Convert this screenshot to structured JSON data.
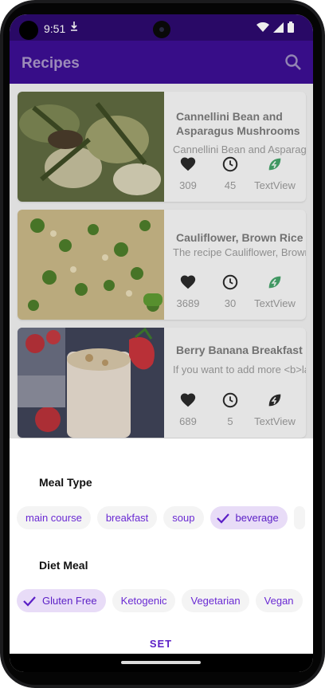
{
  "status_bar": {
    "time": "9:51"
  },
  "app_bar": {
    "title": "Recipes",
    "search_icon": "search-icon"
  },
  "recipes": [
    {
      "title": "Cannellini Bean and Asparagus Mushrooms",
      "description": "Cannellini Bean and Asparagus Mushrooms",
      "likes": "309",
      "minutes": "45",
      "vegan_label": "TextView",
      "vegan": true
    },
    {
      "title": "Cauliflower, Brown Rice, and Vegetable Fried Rice",
      "description": "The recipe Cauliflower, Brown Rice, and Vegetable Fried Rice",
      "likes": "3689",
      "minutes": "30",
      "vegan_label": "TextView",
      "vegan": true
    },
    {
      "title": "Berry Banana Breakfast Smoothie",
      "description": "If you want to add more <b>lacto ovo vegetarian</b>",
      "likes": "689",
      "minutes": "5",
      "vegan_label": "TextView",
      "vegan": false
    }
  ],
  "filter_sheet": {
    "meal_type": {
      "title": "Meal Type",
      "chips": [
        {
          "label": "main course",
          "selected": false
        },
        {
          "label": "breakfast",
          "selected": false
        },
        {
          "label": "soup",
          "selected": false
        },
        {
          "label": "beverage",
          "selected": true
        }
      ]
    },
    "diet": {
      "title": "Diet Meal",
      "chips": [
        {
          "label": "Gluten Free",
          "selected": true
        },
        {
          "label": "Ketogenic",
          "selected": false
        },
        {
          "label": "Vegetarian",
          "selected": false
        },
        {
          "label": "Vegan",
          "selected": false
        }
      ]
    },
    "set_label": "SET"
  },
  "colors": {
    "status_bar": "#2d0a6e",
    "app_bar": "#3c0e93",
    "accent": "#5b1fc6",
    "chip_selected_bg": "#e8dcf7",
    "vegan_green": "#45a36a"
  },
  "icons": [
    "heart-icon",
    "clock-icon",
    "leaf-icon",
    "check-icon",
    "wifi-icon",
    "signal-icon",
    "battery-icon",
    "download-icon"
  ]
}
